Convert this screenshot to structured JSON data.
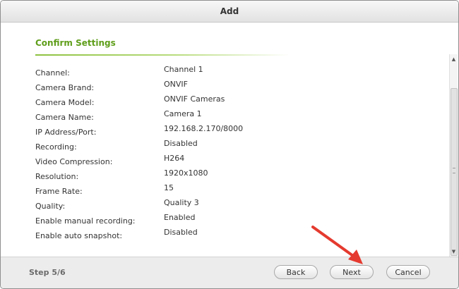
{
  "dialog": {
    "title": "Add"
  },
  "section": {
    "title": "Confirm Settings"
  },
  "settings": [
    {
      "label": "Channel:",
      "value": "Channel 1"
    },
    {
      "label": "Camera Brand:",
      "value": "ONVIF"
    },
    {
      "label": "Camera Model:",
      "value": "ONVIF Cameras"
    },
    {
      "label": "Camera Name:",
      "value": "Camera 1"
    },
    {
      "label": "IP Address/Port:",
      "value": "192.168.2.170/8000"
    },
    {
      "label": "Recording:",
      "value": "Disabled"
    },
    {
      "label": "Video Compression:",
      "value": "H264"
    },
    {
      "label": "Resolution:",
      "value": "1920x1080"
    },
    {
      "label": "Frame Rate:",
      "value": "15"
    },
    {
      "label": "Quality:",
      "value": "Quality 3"
    },
    {
      "label": "Enable manual recording:",
      "value": "Enabled"
    },
    {
      "label": "Enable auto snapshot:",
      "value": "Disabled"
    }
  ],
  "footer": {
    "step": "Step 5/6",
    "back_label": "Back",
    "next_label": "Next",
    "cancel_label": "Cancel"
  },
  "annotation": {
    "arrow_color": "#e53a2f"
  }
}
